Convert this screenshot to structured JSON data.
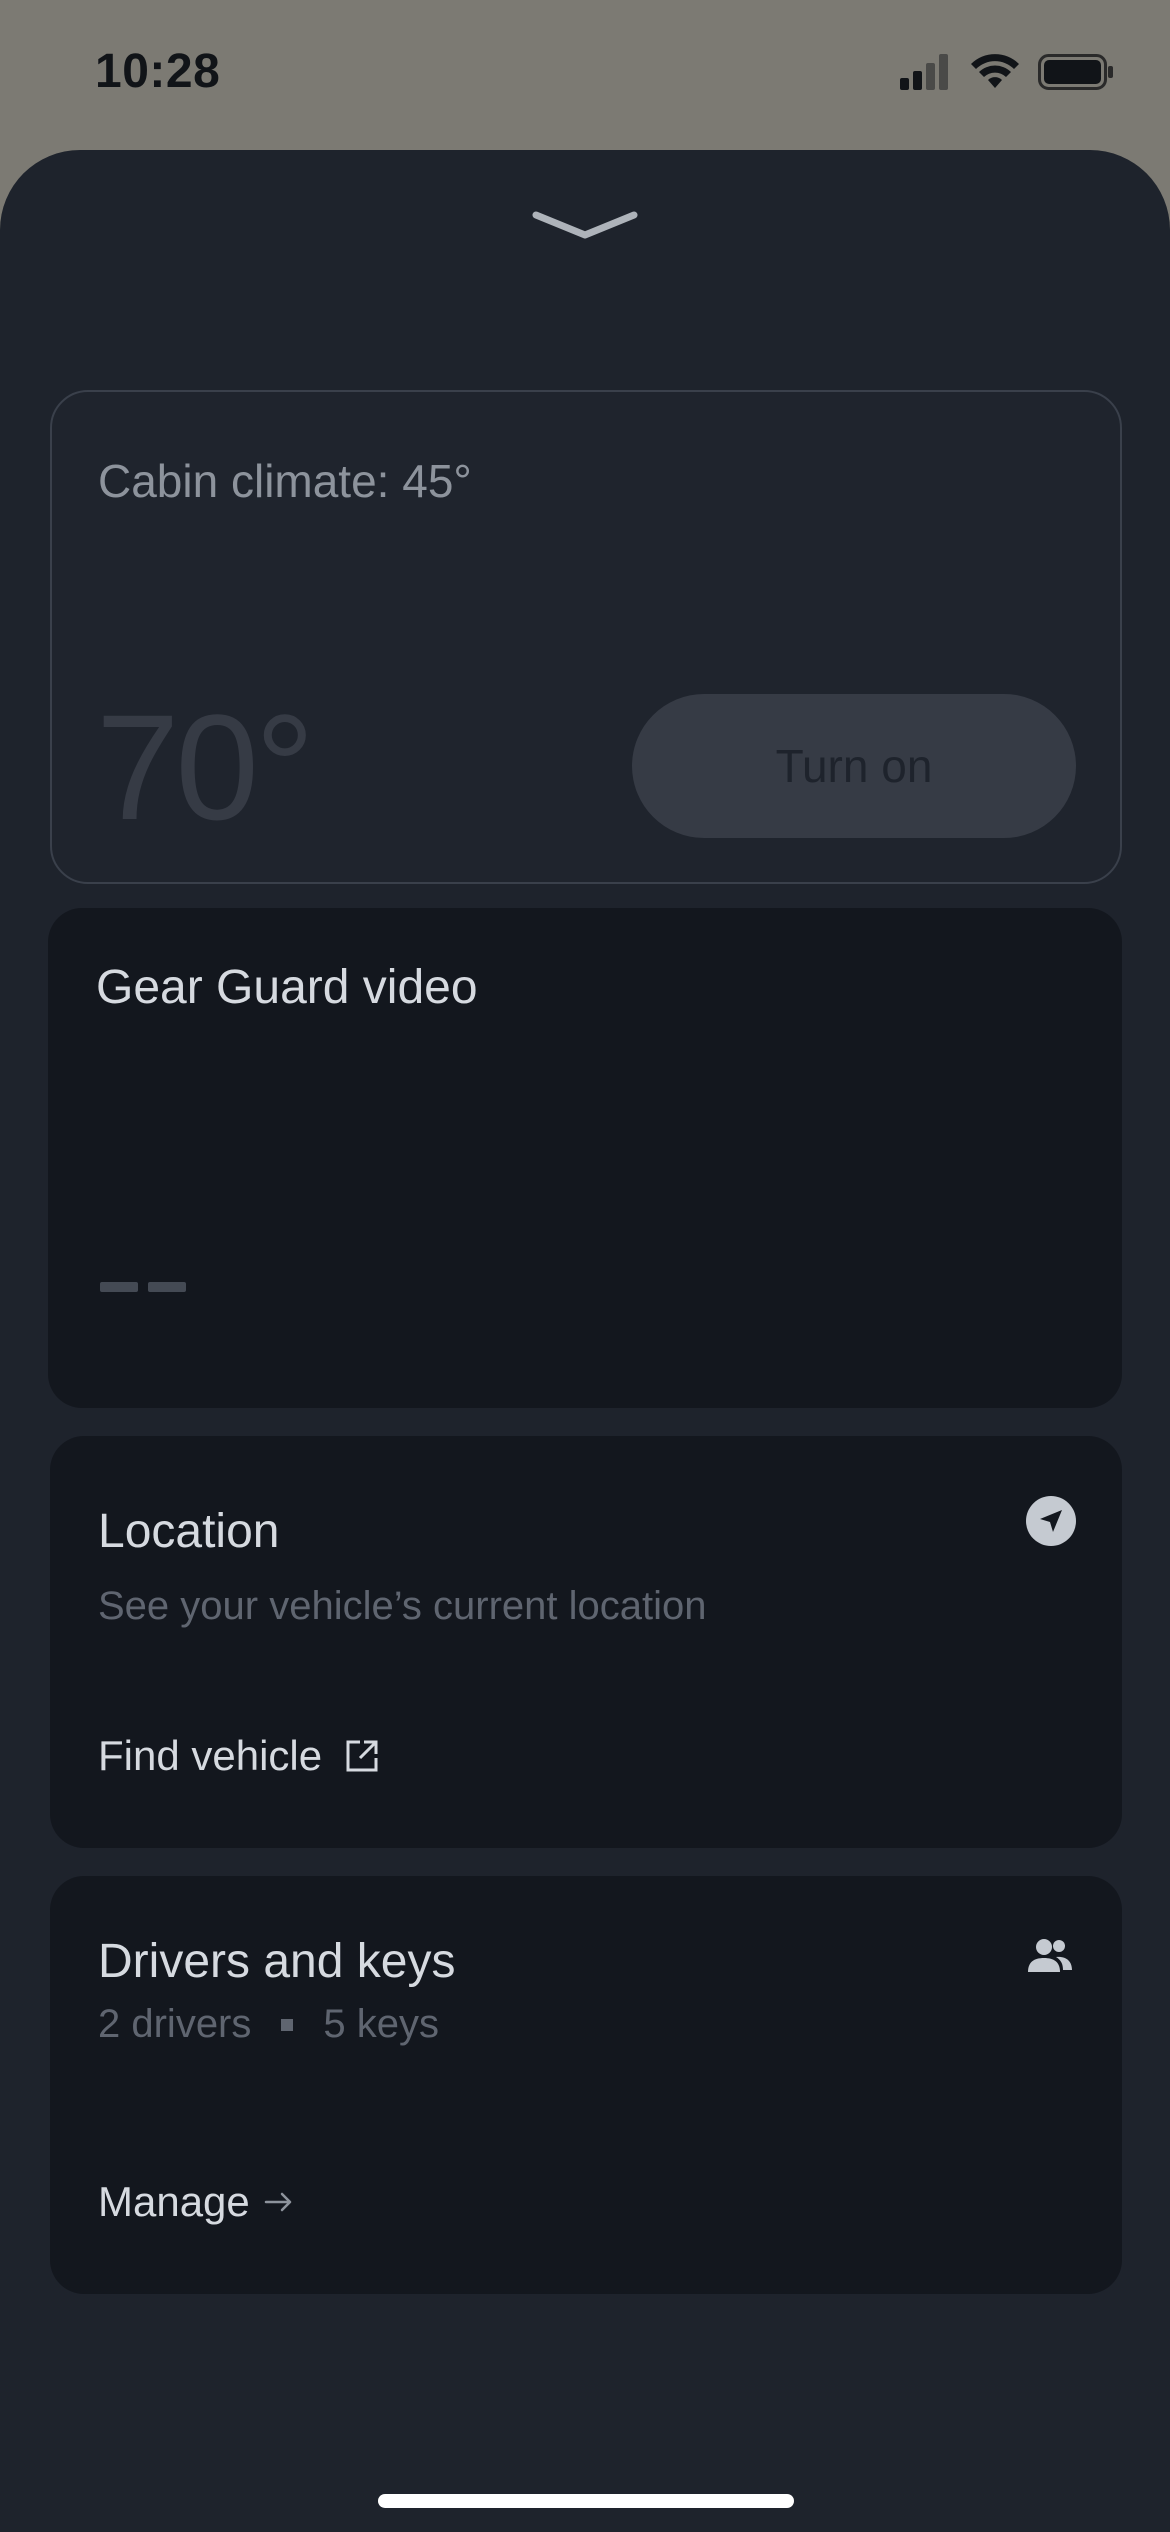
{
  "status_bar": {
    "time": "10:28",
    "icons": [
      "cellular-signal-icon",
      "wifi-icon",
      "battery-icon"
    ]
  },
  "sheet": {
    "collapse_icon": "chevron-down-icon"
  },
  "climate": {
    "title": "Cabin climate: 45°",
    "target_temp": "70°",
    "button_label": "Turn on"
  },
  "gear_guard": {
    "title": "Gear Guard video",
    "value": "--"
  },
  "location": {
    "title": "Location",
    "subtitle": "See your vehicle’s current location",
    "action_label": "Find vehicle",
    "icon": "navigation-arrow-icon",
    "action_icon": "external-link-icon"
  },
  "drivers": {
    "title": "Drivers and keys",
    "drivers_count": "2 drivers",
    "keys_count": "5 keys",
    "action_label": "Manage",
    "icon": "people-icon",
    "action_icon": "arrow-right-icon"
  },
  "colors": {
    "sheet_background": "#1e232c",
    "card_background": "#13171e",
    "backdrop": "#7c7a73",
    "primary_text": "#d6dae0",
    "secondary_text": "#5f6570"
  }
}
